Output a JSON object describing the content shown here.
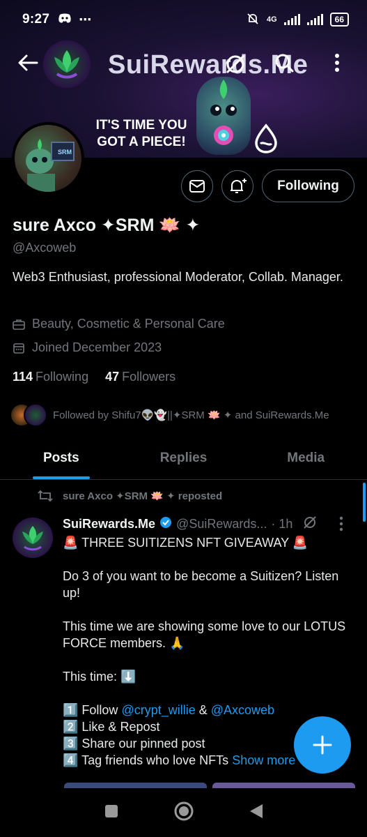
{
  "status_bar": {
    "time": "9:27",
    "network": "4G",
    "battery": "66"
  },
  "banner": {
    "brand_text": "SuiRewards.Me",
    "tagline": "IT'S TIME YOU GOT A PIECE!"
  },
  "profile": {
    "avatar_text": "SRM",
    "display_name": "sure Axco ✦SRM 🪷 ✦",
    "handle": "@Axcoweb",
    "bio": "Web3 Enthusiast, professional Moderator,  Collab. Manager.",
    "category": "Beauty, Cosmetic & Personal Care",
    "joined": "Joined December 2023",
    "following_count": "114",
    "following_label": "Following",
    "followers_count": "47",
    "followers_label": "Followers",
    "follow_button": "Following",
    "followed_by": "Followed by Shifu7👽👻||✦SRM 🪷 ✦ and SuiRewards.Me"
  },
  "tabs": [
    "Posts",
    "Replies",
    "Media"
  ],
  "post": {
    "repost_label": "sure Axco ✦SRM 🪷 ✦ reposted",
    "author_name": "SuiRewards.Me",
    "author_handle": "@SuiRewards...",
    "time": "· 1h",
    "line1": "🚨 THREE SUITIZENS NFT GIVEAWAY 🚨",
    "line2": "Do 3 of you want to be become a Suitizen? Listen up!",
    "line3": "This time we are showing some love to our LOTUS FORCE members. 🙏",
    "line4": "This time: ⬇️",
    "step1_prefix": "1️⃣ Follow ",
    "step1_link1": "@crypt_willie",
    "step1_and": " & ",
    "step1_link2": "@Axcoweb",
    "step2": "2️⃣ Like & Repost",
    "step3": "3️⃣ Share our pinned post",
    "step4": "4️⃣ Tag friends who love NFTs ",
    "show_more": "Show more"
  },
  "colors": {
    "accent": "#1d9bf0",
    "verified": "#1d9bf0",
    "muted": "#71767b",
    "background": "#000000"
  }
}
